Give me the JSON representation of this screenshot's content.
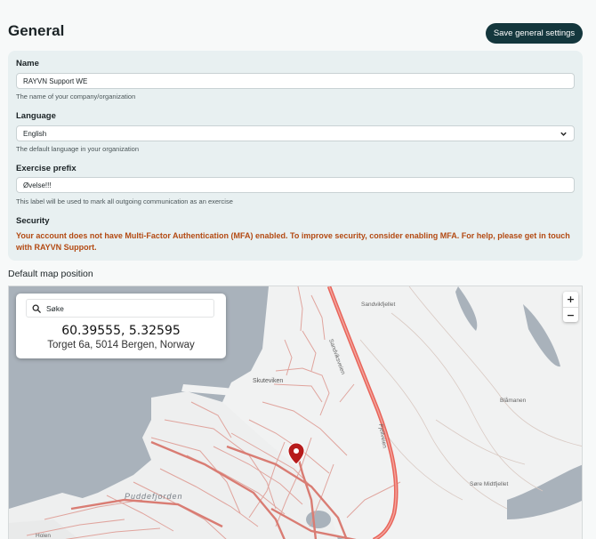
{
  "header": {
    "title": "General",
    "save_label": "Save general settings"
  },
  "form": {
    "name": {
      "label": "Name",
      "value": "RAYVN Support WE",
      "helper": "The name of your company/organization"
    },
    "language": {
      "label": "Language",
      "value": "English",
      "helper": "The default language in your organization"
    },
    "exercise_prefix": {
      "label": "Exercise prefix",
      "value": "Øvelse!!!",
      "helper": "This label will be used to mark all outgoing communication as an exercise"
    },
    "security": {
      "label": "Security",
      "warning": "Your account does not have Multi-Factor Authentication (MFA) enabled. To improve security, consider enabling MFA. For help, please get in touch with RAYVN Support."
    }
  },
  "map": {
    "section_title": "Default map position",
    "search_placeholder": "Søke",
    "coordinates": "60.39555, 5.32595",
    "address": "Torget 6a, 5014 Bergen, Norway",
    "zoom_in": "+",
    "zoom_out": "−",
    "place_labels": {
      "sandvikfjellet": "Sandvikfjellet",
      "skuteviken": "Skuteviken",
      "blamanen": "Blåmanen",
      "sore_midtfjellet": "Søre Midtfjellet",
      "puddefjorden": "Puddefjorden",
      "holen": "Holen",
      "sandviksveien": "Sandviksveien",
      "fjellveien": "Fjellveien"
    }
  },
  "colors": {
    "accent": "#14373d",
    "warning": "#b34a13",
    "panel": "#e8f0f1",
    "water": "#a9b2bb",
    "road": "#e0837a",
    "main_road": "#e8645a",
    "marker": "#b71c1c"
  },
  "icons": {
    "search": "search-icon",
    "select": "chevron-down-icon",
    "marker": "map-pin-icon"
  }
}
